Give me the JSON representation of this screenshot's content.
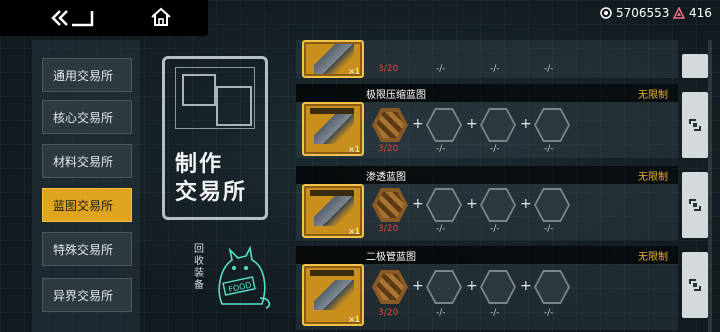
{
  "currencies": [
    {
      "icon": "coin-icon",
      "value": "5706553"
    },
    {
      "icon": "crystal-icon",
      "value": "416"
    }
  ],
  "sidebar": {
    "items": [
      {
        "label": "通用交易所",
        "active": false
      },
      {
        "label": "核心交易所",
        "active": false
      },
      {
        "label": "材料交易所",
        "active": false
      },
      {
        "label": "蓝图交易所",
        "active": true
      },
      {
        "label": "特殊交易所",
        "active": false
      },
      {
        "label": "异界交易所",
        "active": false
      }
    ]
  },
  "title_card": {
    "line1": "制作",
    "line2": "交易所"
  },
  "recycle": {
    "label": "回收装备",
    "mascot_text": "FOOD"
  },
  "rows": [
    {
      "name": "",
      "limit": "",
      "count": "3/20",
      "slots": [
        "-/-",
        "-/-",
        "-/-"
      ]
    },
    {
      "name": "极限压缩蓝图",
      "limit": "无限制",
      "count": "3/20",
      "slots": [
        "-/-",
        "-/-",
        "-/-"
      ]
    },
    {
      "name": "渗透蓝图",
      "limit": "无限制",
      "count": "3/20",
      "slots": [
        "-/-",
        "-/-",
        "-/-"
      ]
    },
    {
      "name": "二极管蓝图",
      "limit": "无限制",
      "count": "3/20",
      "slots": [
        "-/-",
        "-/-",
        "-/-"
      ]
    }
  ],
  "product_qty": "×1",
  "plus_sign": "+",
  "colors": {
    "accent": "#e0a41f",
    "limit_text": "#e8b12a",
    "count_red": "#e0453b"
  }
}
